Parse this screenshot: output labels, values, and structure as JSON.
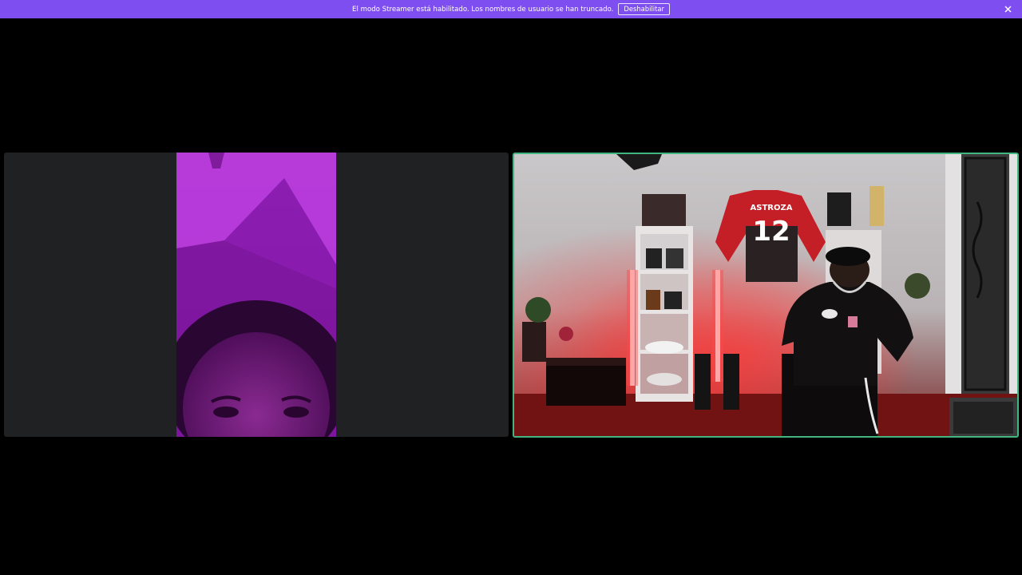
{
  "banner": {
    "message": "El modo Streamer está habilitado. Los nombres de usuario se han truncado.",
    "disable_button": "Deshabilitar",
    "background": "#7f4ef0"
  },
  "call": {
    "left_participant": {
      "feed": "video-feed",
      "speaking": false
    },
    "right_participant": {
      "feed": "video-feed",
      "speaking": true,
      "speaking_border_color": "#43b581",
      "jersey_name": "ASTROZA",
      "jersey_number": "12"
    }
  },
  "icons": {
    "close": "close-icon"
  }
}
